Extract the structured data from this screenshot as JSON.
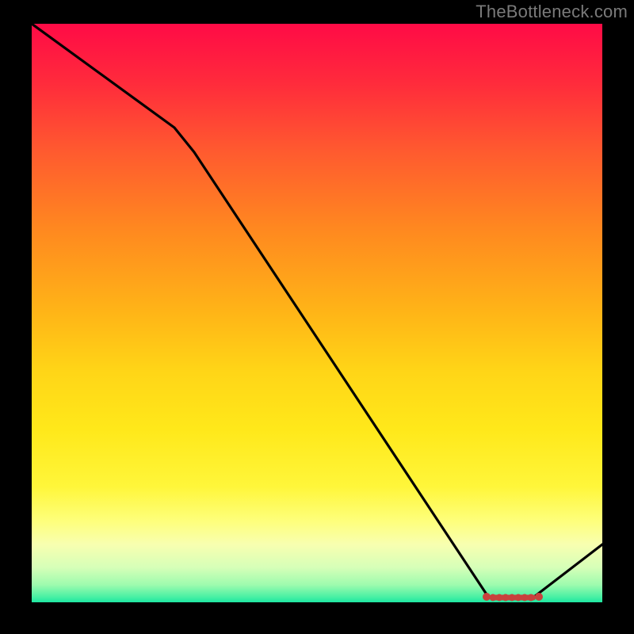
{
  "attribution": "TheBottleneck.com",
  "chart_data": {
    "type": "line",
    "x": [
      0,
      25,
      80,
      88,
      100
    ],
    "values": [
      100,
      82,
      1,
      1,
      10
    ],
    "xlim": [
      0,
      100
    ],
    "ylim": [
      0,
      100
    ],
    "title": "",
    "xlabel": "",
    "ylabel": "",
    "marker_band": {
      "x_start": 80,
      "x_end": 90,
      "y": 1
    },
    "colors": {
      "line": "#000000",
      "marker": "#c8413d",
      "background_top": "#ff0b46",
      "background_bottom": "#1de7a1"
    }
  }
}
